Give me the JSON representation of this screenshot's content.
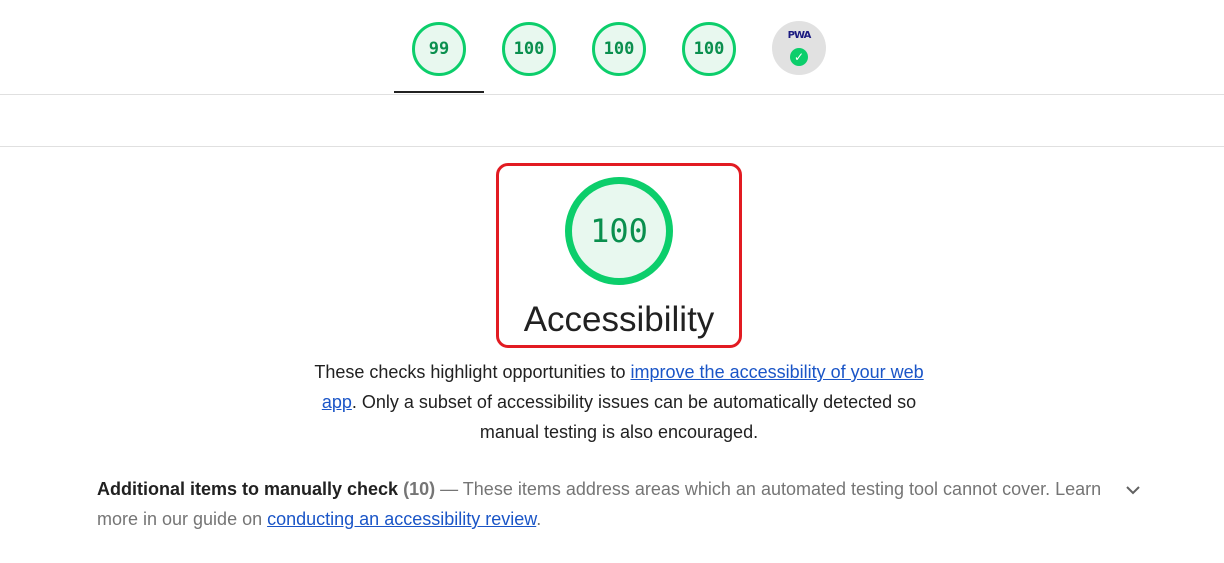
{
  "scores": [
    "99",
    "100",
    "100",
    "100"
  ],
  "pwa": {
    "label": "PWA",
    "check_icon": "check-icon"
  },
  "category": {
    "score": "100",
    "title": "Accessibility"
  },
  "description": {
    "before": "These checks highlight opportunities to ",
    "link": "improve the accessibility of your web app",
    "after": ". Only a subset of accessibility issues can be automatically detected so manual testing is also encouraged."
  },
  "manual": {
    "title": "Additional items to manually check",
    "count": "(10)",
    "dash": "—",
    "text": " These items address areas which an automated testing tool cannot cover. Learn more in our guide on ",
    "link": "conducting an accessibility review",
    "after": "."
  },
  "colors": {
    "pass": "#0cce6b",
    "highlight": "#e21b22",
    "link": "#1a55c7"
  }
}
